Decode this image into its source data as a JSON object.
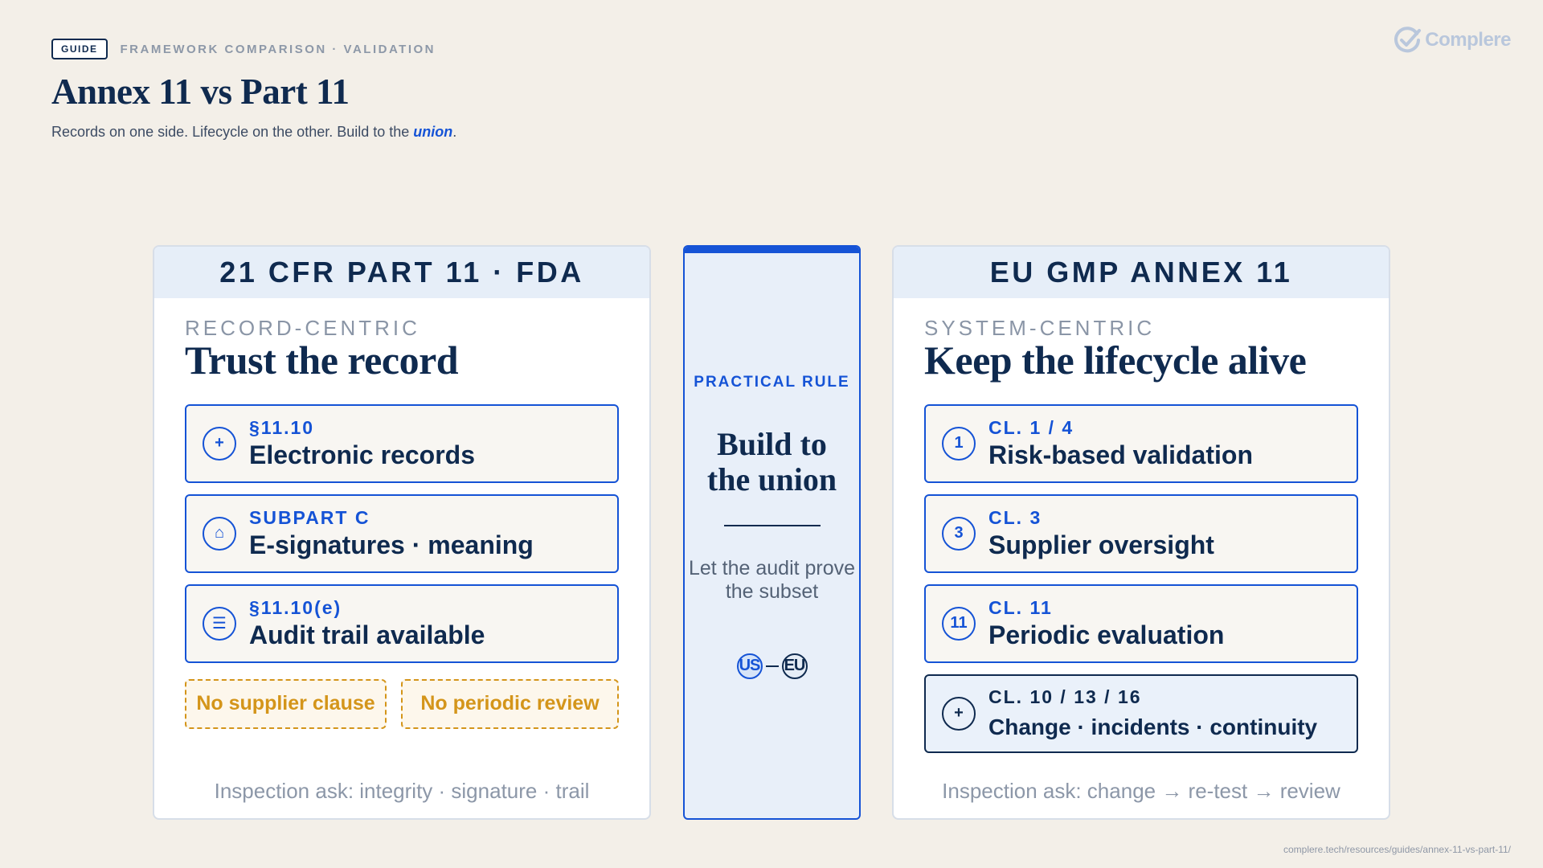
{
  "header": {
    "badge": "GUIDE",
    "eyebrow": "FRAMEWORK COMPARISON · VALIDATION",
    "title": "Annex 11 vs Part 11",
    "subtitle_prefix": "Records on one side. Lifecycle on the other. Build to the ",
    "subtitle_emphasis": "union",
    "subtitle_suffix": "."
  },
  "logo": {
    "text": "Complere",
    "icon": "check-circle-icon"
  },
  "left": {
    "head": "21 CFR PART 11 · FDA",
    "kicker": "RECORD-CENTRIC",
    "title": "Trust the record",
    "items": [
      {
        "icon": "plus-icon",
        "glyph": "+",
        "tag": "§11.10",
        "label": "Electronic records"
      },
      {
        "icon": "signature-icon",
        "glyph": "⌂",
        "tag": "SUBPART C",
        "label": "E-signatures · meaning"
      },
      {
        "icon": "list-icon",
        "glyph": "☰",
        "tag": "§11.10(e)",
        "label": "Audit trail available"
      }
    ],
    "gaps": [
      "No supplier clause",
      "No periodic review"
    ],
    "ask": "Inspection ask: integrity · signature · trail"
  },
  "center": {
    "kicker": "PRACTICAL RULE",
    "title": "Build to the union",
    "note": "Let the audit prove the subset",
    "flag_us": "US",
    "flag_eu": "EU"
  },
  "right": {
    "head": "EU GMP ANNEX 11",
    "kicker": "SYSTEM-CENTRIC",
    "title": "Keep the lifecycle alive",
    "items": [
      {
        "icon": "number-icon",
        "glyph": "1",
        "tag": "CL. 1 / 4",
        "label": "Risk-based validation"
      },
      {
        "icon": "number-icon",
        "glyph": "3",
        "tag": "CL. 3",
        "label": "Supplier oversight"
      },
      {
        "icon": "number-icon",
        "glyph": "11",
        "tag": "CL. 11",
        "label": "Periodic evaluation"
      },
      {
        "icon": "plus-icon",
        "glyph": "+",
        "tag": "CL. 10 / 13 / 16",
        "label": "Change · incidents · continuity"
      }
    ],
    "ask": "Inspection ask: change → re-test → review"
  },
  "url": "complere.tech/resources/guides/annex-11-vs-part-11/",
  "colors": {
    "accent": "#1553d6",
    "navy": "#0f2a4f",
    "warning": "#d4951a",
    "background": "#f3efe8"
  }
}
